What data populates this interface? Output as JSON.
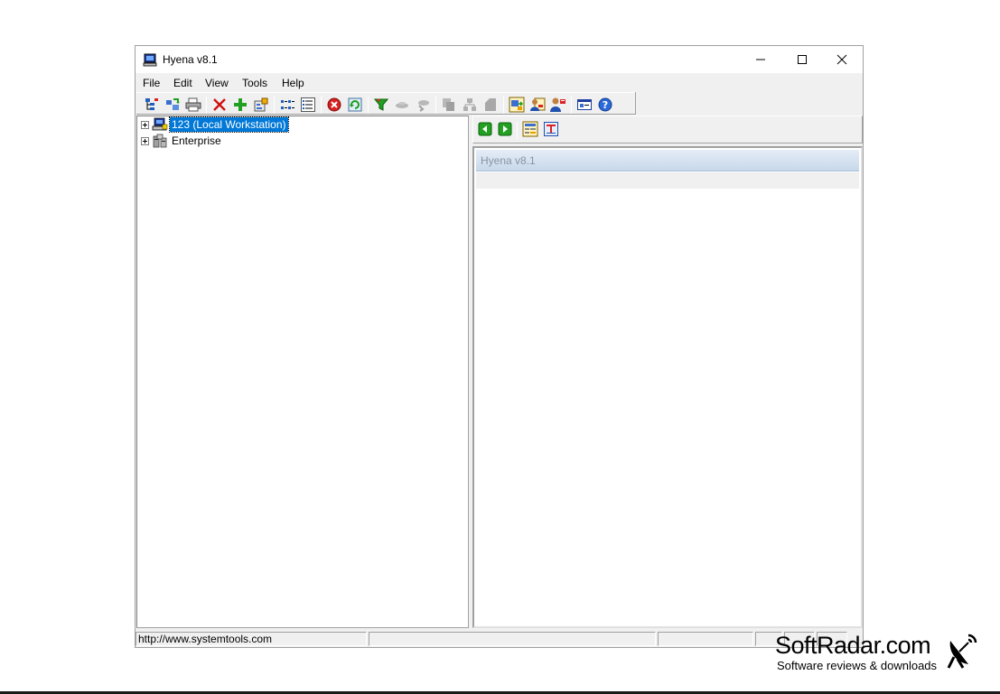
{
  "window": {
    "title": "Hyena v8.1",
    "controls": {
      "minimize": "minimize-icon",
      "maximize": "maximize-icon",
      "close": "close-icon"
    }
  },
  "menu": {
    "items": [
      {
        "label": "File"
      },
      {
        "label": "Edit"
      },
      {
        "label": "View"
      },
      {
        "label": "Tools"
      },
      {
        "label": "Help"
      }
    ]
  },
  "toolbar": {
    "buttons": [
      {
        "icon": "tree-view-icon"
      },
      {
        "icon": "refresh-tree-icon"
      },
      {
        "icon": "print-icon"
      },
      {
        "icon": "delete-icon"
      },
      {
        "icon": "add-icon"
      },
      {
        "icon": "properties-icon"
      },
      {
        "icon": "small-icons-view-icon"
      },
      {
        "icon": "details-view-icon"
      },
      {
        "icon": "stop-icon"
      },
      {
        "icon": "refresh-icon"
      },
      {
        "icon": "filter-icon"
      },
      {
        "icon": "connect-icon"
      },
      {
        "icon": "disconnect-icon"
      },
      {
        "icon": "copy-icon"
      },
      {
        "icon": "network-icon"
      },
      {
        "icon": "document-icon"
      },
      {
        "icon": "export-icon"
      },
      {
        "icon": "user-export-icon"
      },
      {
        "icon": "user-settings-icon"
      },
      {
        "icon": "console-icon"
      },
      {
        "icon": "help-icon"
      }
    ]
  },
  "tree": {
    "nodes": [
      {
        "label": "123 (Local Workstation)",
        "icon": "workstation-icon",
        "selected": true
      },
      {
        "label": "Enterprise",
        "icon": "enterprise-icon",
        "selected": false
      }
    ]
  },
  "right_pane": {
    "toolbar": [
      {
        "icon": "back-icon"
      },
      {
        "icon": "forward-icon"
      },
      {
        "icon": "grid-view-icon"
      },
      {
        "icon": "text-view-icon"
      }
    ],
    "header": "Hyena v8.1"
  },
  "statusbar": {
    "url": "http://www.systemtools.com"
  },
  "watermark": {
    "title": "SoftRadar.com",
    "subtitle": "Software reviews & downloads"
  }
}
